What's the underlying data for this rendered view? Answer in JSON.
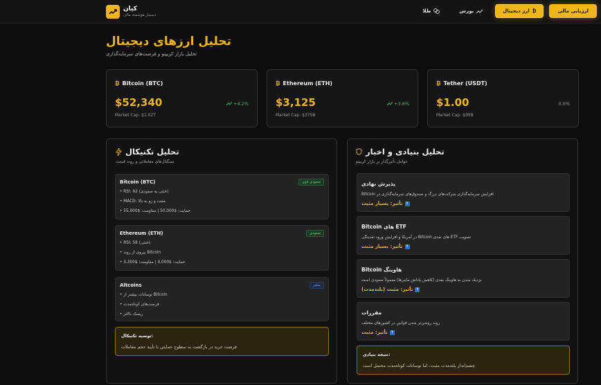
{
  "brand": {
    "name": "کیان",
    "subtitle": "دستیار هوشمند مالی"
  },
  "nav": [
    {
      "label": "ارزیابی مالی",
      "kind": "primary"
    },
    {
      "label": "ارز دیجیتال",
      "kind": "active",
      "icon": "₿"
    },
    {
      "label": "بورس",
      "kind": "plain",
      "icon": "trend-icon"
    },
    {
      "label": "طلا",
      "kind": "plain",
      "icon": "coins-icon"
    }
  ],
  "page": {
    "title": "تحلیل ارزهای دیجیتال",
    "subtitle": "تحلیل بازار کریپتو و فرصت‌های سرمایه‌گذاری"
  },
  "prices": [
    {
      "name": "Bitcoin (BTC)",
      "symbol": "₿",
      "price": "$52,340",
      "change": "+4.2%",
      "mcap": "Market Cap: $1.02T",
      "trend": "up"
    },
    {
      "name": "Ethereum (ETH)",
      "symbol": "₿",
      "price": "$3,125",
      "change": "+3.8%",
      "mcap": "Market Cap: $375B",
      "trend": "up"
    },
    {
      "name": "Tether (USDT)",
      "symbol": "₿",
      "price": "$1.00",
      "change": "0.0%",
      "mcap": "Market Cap: $95B",
      "trend": "neutral"
    }
  ],
  "technical": {
    "title": "تحلیل تکنیکال",
    "subtitle": "سیگنال‌های معاملاتی و روند قیمت",
    "items": [
      {
        "title": "Bitcoin (BTC)",
        "badge": "صعودی قوی",
        "badge_color": "green",
        "bullets": [
          "• RSI: 62 (خنثی به صعودی)",
          "• MACD: مثبت و رو به بالا",
          "• حمایت: $50,000 | مقاومت: $55,000"
        ]
      },
      {
        "title": "Ethereum (ETH)",
        "badge": "صعودی",
        "badge_color": "green",
        "bullets": [
          "• RSI: 58 (خنثی)",
          "• پیروی از روند Bitcoin",
          "• حمایت: $3,000 | مقاومت: $3,300"
        ]
      },
      {
        "title": "Altcoins",
        "badge": "متغیر",
        "badge_color": "blue",
        "bullets": [
          "• نوسانات بیشتر از Bitcoin",
          "• فرصت‌های کوتاه‌مدت",
          "• ریسک بالاتر"
        ]
      }
    ],
    "recommendation": {
      "title": "توصیه تکنیکال:",
      "text": "فرصت خرید در بازگشت به سطوح حمایتی با تأیید حجم معاملات"
    }
  },
  "fundamental": {
    "title": "تحلیل بنیادی و اخبار",
    "subtitle": "عوامل تأثیرگذار بر بازار کریپتو",
    "items": [
      {
        "title": "پذیرش نهادی",
        "desc": "افزایش سرمایه‌گذاری شرکت‌های بزرگ و صندوق‌های سرمایه‌گذاری در Bitcoin",
        "impact": "تأثیر: بسیار مثبت"
      },
      {
        "title": "ETF های Bitcoin",
        "desc": "تصویب ETF های نقدی Bitcoin در آمریکا و افزایش ورود نقدینگی",
        "impact": "تأثیر: بسیار مثبت"
      },
      {
        "title": "هاوینگ Bitcoin",
        "desc": "نزدیک شدن به هاوینگ بعدی (کاهش پاداش ماینرها) معمولاً صعودی است",
        "impact": "تأثیر: مثبت (بلندمدت)"
      },
      {
        "title": "مقررات",
        "desc": "روند روشن‌تر شدن قوانین در کشورهای مختلف",
        "impact": "تأثیر: مثبت"
      }
    ],
    "conclusion": {
      "title": "نتیجه بنیادی:",
      "text": "چشم‌انداز بلندمدت مثبت، اما نوسانات کوتاه‌مدت محتمل است"
    }
  },
  "colors": {
    "accent": "#f1b61c",
    "positive": "#3cc26a",
    "background": "#0d0d0d",
    "card": "#151515"
  }
}
